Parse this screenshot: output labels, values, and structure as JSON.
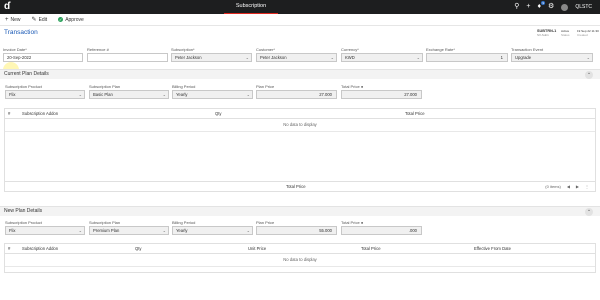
{
  "topbar": {
    "logo_glyph": "ɗ",
    "app_title": "Subscription",
    "notif_count": "9",
    "company": "QLSTC",
    "icons": [
      "search-icon",
      "plus-icon",
      "bell-icon",
      "gear-icon",
      "avatar"
    ]
  },
  "actions": {
    "new_label": "New",
    "edit_label": "Edit",
    "approve_label": "Approve"
  },
  "page": {
    "title": "Transaction",
    "subscription_no": "SUBTRN-1",
    "subscription_sub": "SV-Sub1",
    "status_label": "Active",
    "status_sub": "Status",
    "date_label": "19 Sep 22 11:30",
    "date_sub": "Created"
  },
  "header_fields": {
    "invoice_date": {
      "label": "Invoice Date*",
      "value": "20-Sep-2022"
    },
    "reference": {
      "label": "Reference #",
      "value": ""
    },
    "subscription": {
      "label": "Subscription*",
      "value": "Peter Jackson"
    },
    "customer": {
      "label": "Customer*",
      "value": "Peter Jackson"
    },
    "currency": {
      "label": "Currency*",
      "value": "KWD"
    },
    "exchange_rate": {
      "label": "Exchange Rate*",
      "value": "1"
    },
    "transaction_event": {
      "label": "Transaction Event",
      "value": "Upgrade"
    }
  },
  "current_plan": {
    "section_title": "Current Plan Details",
    "product": {
      "label": "Subscription Product",
      "value": "Flix"
    },
    "plan": {
      "label": "Subscription Plan",
      "value": "Basic Plan"
    },
    "billing": {
      "label": "Billing Period",
      "value": "Yearly"
    },
    "price": {
      "label": "Plan Price",
      "value": "27.000"
    },
    "total": {
      "label": "Total Price",
      "value": "27.000"
    },
    "table": {
      "columns": [
        "#",
        "Subscription Addon",
        "Qty",
        "Total Price"
      ],
      "empty_text": "No data to display",
      "footer_label": "Total Price",
      "items_label": "(0 items)"
    }
  },
  "new_plan": {
    "section_title": "New Plan Details",
    "product": {
      "label": "Subscription Product",
      "value": "Flix"
    },
    "plan": {
      "label": "Subscription Plan",
      "value": "Premium Plan"
    },
    "billing": {
      "label": "Billing Period",
      "value": "Yearly"
    },
    "price": {
      "label": "Plan Price",
      "value": "55.000"
    },
    "total": {
      "label": "Total Price",
      "value": ".000"
    },
    "table": {
      "columns": [
        "#",
        "Subscription Addon",
        "Qty",
        "Unit Price",
        "Total Price",
        "Effective From Date"
      ],
      "empty_text": "No data to display"
    }
  },
  "colors": {
    "accent": "#1a59b5",
    "topbar": "#1d1e1f",
    "active_tab_underline": "#e0281f",
    "approve": "#2aa15a"
  }
}
